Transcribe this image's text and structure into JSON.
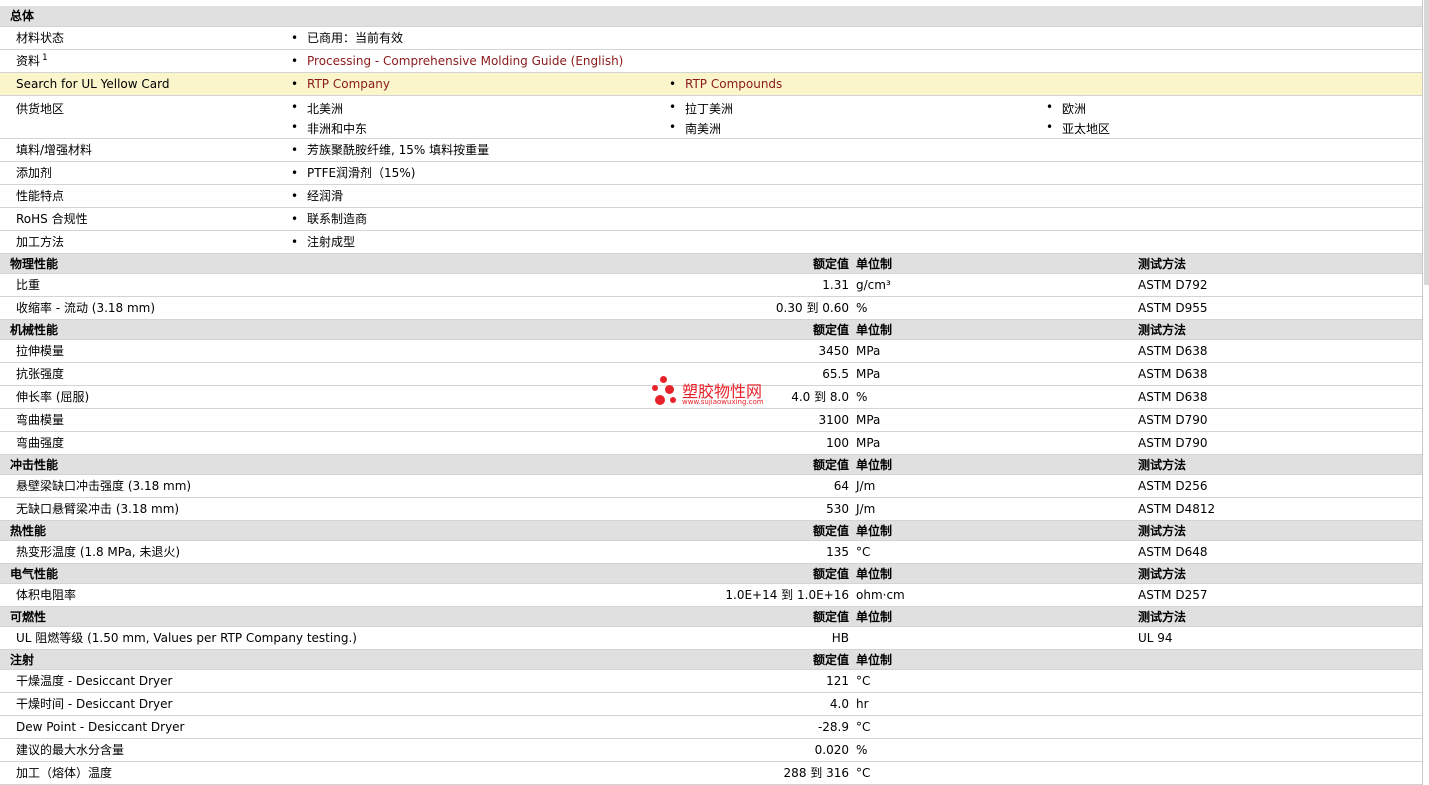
{
  "general": {
    "header": "总体",
    "material_status": {
      "label": "材料状态",
      "value": "已商用：当前有效"
    },
    "docs": {
      "label": "资料",
      "sup": "1",
      "link": "Processing - Comprehensive Molding Guide (English)"
    },
    "yellow_card": {
      "label": "Search for UL Yellow Card",
      "links": [
        "RTP Company",
        "RTP Compounds"
      ]
    },
    "supply": {
      "label": "供货地区",
      "regions": [
        "北美洲",
        "拉丁美洲",
        "欧洲",
        "非洲和中东",
        "南美洲",
        "亚太地区"
      ]
    },
    "filler": {
      "label": "填料/增强材料",
      "value": "芳族聚酰胺纤维, 15% 填料按重量"
    },
    "additive": {
      "label": "添加剂",
      "value": "PTFE润滑剂（15%)"
    },
    "features": {
      "label": "性能特点",
      "value": "经润滑"
    },
    "rohs": {
      "label": "RoHS 合规性",
      "value": "联系制造商"
    },
    "processing": {
      "label": "加工方法",
      "value": "注射成型"
    }
  },
  "columns": {
    "value": "额定值",
    "unit": "单位制",
    "test": "测试方法"
  },
  "sections": [
    {
      "title": "物理性能",
      "show_test": true,
      "rows": [
        {
          "label": "比重",
          "value": "1.31",
          "unit": "g/cm³",
          "test": "ASTM D792"
        },
        {
          "label": "收缩率  - 流动  (3.18 mm)",
          "value": "0.30 到  0.60",
          "unit": "%",
          "test": "ASTM D955"
        }
      ]
    },
    {
      "title": "机械性能",
      "show_test": true,
      "rows": [
        {
          "label": "拉伸模量",
          "value": "3450",
          "unit": "MPa",
          "test": "ASTM D638"
        },
        {
          "label": "抗张强度",
          "value": "65.5",
          "unit": "MPa",
          "test": "ASTM D638"
        },
        {
          "label": "伸长率  (屈服)",
          "value": "4.0 到  8.0",
          "unit": "%",
          "test": "ASTM D638"
        },
        {
          "label": "弯曲模量",
          "value": "3100",
          "unit": "MPa",
          "test": "ASTM D790"
        },
        {
          "label": "弯曲强度",
          "value": "100",
          "unit": "MPa",
          "test": "ASTM D790"
        }
      ]
    },
    {
      "title": "冲击性能",
      "show_test": true,
      "rows": [
        {
          "label": "悬壁梁缺口冲击强度  (3.18 mm)",
          "value": "64",
          "unit": "J/m",
          "test": "ASTM D256"
        },
        {
          "label": "无缺口悬臂梁冲击  (3.18 mm)",
          "value": "530",
          "unit": "J/m",
          "test": "ASTM D4812"
        }
      ]
    },
    {
      "title": "热性能",
      "show_test": true,
      "rows": [
        {
          "label": "热变形温度  (1.8 MPa, 未退火)",
          "value": "135",
          "unit": "°C",
          "test": "ASTM D648"
        }
      ]
    },
    {
      "title": "电气性能",
      "show_test": true,
      "rows": [
        {
          "label": "体积电阻率",
          "value": "1.0E+14 到  1.0E+16",
          "unit": "ohm·cm",
          "test": "ASTM D257"
        }
      ]
    },
    {
      "title": "可燃性",
      "show_test": true,
      "rows": [
        {
          "label": "UL 阻燃等级  (1.50 mm, Values per RTP Company testing.)",
          "value": "HB",
          "unit": "",
          "test": "UL 94"
        }
      ]
    },
    {
      "title": "注射",
      "show_test": false,
      "rows": [
        {
          "label": "干燥温度  - Desiccant Dryer",
          "value": "121",
          "unit": "°C",
          "test": ""
        },
        {
          "label": "干燥时间  - Desiccant Dryer",
          "value": "4.0",
          "unit": "hr",
          "test": ""
        },
        {
          "label": "Dew Point - Desiccant Dryer",
          "value": "-28.9",
          "unit": "°C",
          "test": ""
        },
        {
          "label": "建议的最大水分含量",
          "value": "0.020",
          "unit": "%",
          "test": ""
        },
        {
          "label": "加工（熔体）温度",
          "value": "288 到  316",
          "unit": "°C",
          "test": ""
        }
      ]
    }
  ],
  "watermark": {
    "title": "塑胶物性网",
    "url": "www.sujiaowuxing.com"
  },
  "colors": {
    "link": "#8b1a1a",
    "header_bg": "#e0e0e0",
    "highlight_bg": "#fbf5cc",
    "watermark": "#e8222a"
  }
}
